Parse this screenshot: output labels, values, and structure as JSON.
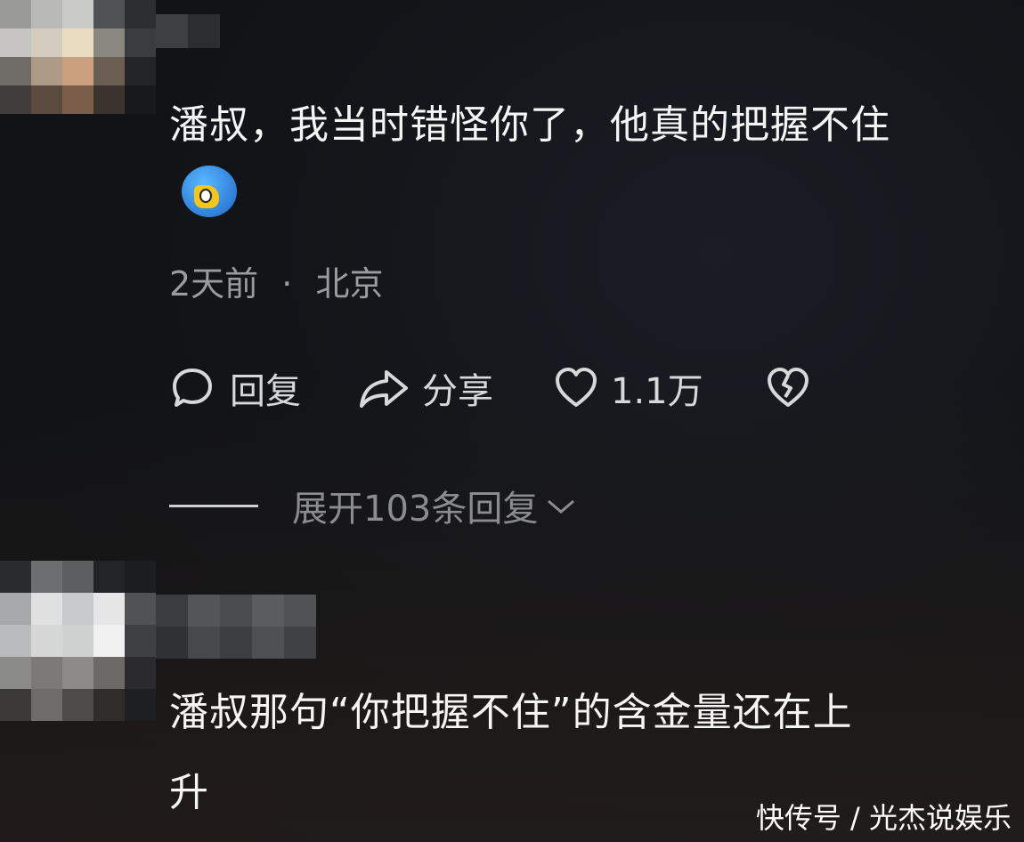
{
  "comments": [
    {
      "text_line1": "潘叔，我当时错怪你了，他真的把握不住",
      "time": "2天前",
      "separator": "·",
      "location": "北京",
      "actions": {
        "reply_label": "回复",
        "share_label": "分享",
        "like_count": "1.1万"
      },
      "expand_label": "展开103条回复"
    },
    {
      "text_line1": "潘叔那句“你把握不住”的含金量还在上",
      "text_line2": "升"
    }
  ],
  "icons": {
    "reply": "chat-bubble-icon",
    "share": "share-arrow-icon",
    "like": "heart-icon",
    "dislike": "broken-heart-icon",
    "expand": "chevron-down-icon",
    "emoji": "emoji-sticker"
  },
  "watermark": "快传号 / 光杰说娱乐"
}
